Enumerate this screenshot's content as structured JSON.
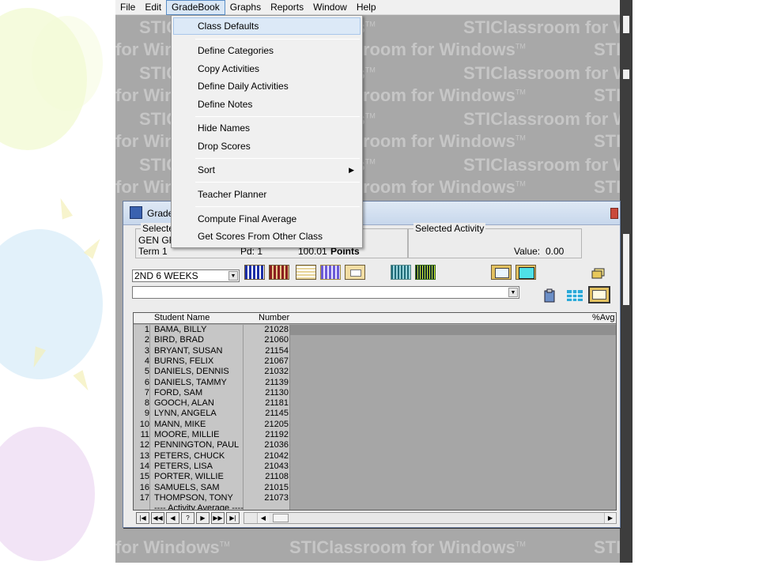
{
  "menubar": {
    "items": [
      "File",
      "Edit",
      "GradeBook",
      "Graphs",
      "Reports",
      "Window",
      "Help"
    ],
    "active": "GradeBook"
  },
  "watermark": {
    "line_a": "STIClassroom for Windows",
    "line_b": "for Windows",
    "tm": "TM"
  },
  "dropdown": {
    "items": [
      {
        "label": "Class Defaults"
      },
      {
        "label": "Define Categories"
      },
      {
        "label": "Copy Activities"
      },
      {
        "label": "Define Daily Activities"
      },
      {
        "label": "Define Notes"
      },
      {
        "label": "Hide Names"
      },
      {
        "label": "Drop Scores"
      },
      {
        "label": "Sort"
      },
      {
        "label": "Teacher Planner"
      },
      {
        "label": "Compute Final Average"
      },
      {
        "label": "Get Scores From Other Class"
      }
    ],
    "highlighted": "Class Defaults",
    "submenu_arrow": "▶"
  },
  "gradebook_window": {
    "title": "Grade",
    "selected_group_legend": "Selecte",
    "class_name": "GEN GR",
    "term": "Term 1",
    "period": "Pd: 1",
    "points_value": "100.01",
    "points_label": "Points",
    "selected_activity_legend": "Selected Activity",
    "value_label": "Value:",
    "value": "0.00",
    "period_select": "2ND 6 WEEKS",
    "category_select": ""
  },
  "grid": {
    "headers": {
      "name": "Student Name",
      "number": "Number",
      "avg": "%Avg"
    },
    "rows": [
      {
        "n": "1",
        "name": "BAMA, BILLY",
        "id": "21028"
      },
      {
        "n": "2",
        "name": "BIRD, BRAD",
        "id": "21060"
      },
      {
        "n": "3",
        "name": "BRYANT, SUSAN",
        "id": "21154"
      },
      {
        "n": "4",
        "name": "BURNS, FELIX",
        "id": "21067"
      },
      {
        "n": "5",
        "name": "DANIELS, DENNIS",
        "id": "21032"
      },
      {
        "n": "6",
        "name": "DANIELS, TAMMY",
        "id": "21139"
      },
      {
        "n": "7",
        "name": "FORD, SAM",
        "id": "21130"
      },
      {
        "n": "8",
        "name": "GOOCH, ALAN",
        "id": "21181"
      },
      {
        "n": "9",
        "name": "LYNN, ANGELA",
        "id": "21145"
      },
      {
        "n": "10",
        "name": "MANN, MIKE",
        "id": "21205"
      },
      {
        "n": "11",
        "name": "MOORE, MILLIE",
        "id": "21192"
      },
      {
        "n": "12",
        "name": "PENNINGTON, PAUL",
        "id": "21036"
      },
      {
        "n": "13",
        "name": "PETERS, CHUCK",
        "id": "21042"
      },
      {
        "n": "14",
        "name": "PETERS, LISA",
        "id": "21043"
      },
      {
        "n": "15",
        "name": "PORTER, WILLIE",
        "id": "21108"
      },
      {
        "n": "16",
        "name": "SAMUELS, SAM",
        "id": "21015"
      },
      {
        "n": "17",
        "name": "THOMPSON, TONY",
        "id": "21073"
      }
    ],
    "footer_row": "---- Activity Average ----"
  },
  "record_nav": [
    "|◀",
    "◀◀",
    "◀",
    "?",
    "▶",
    "▶▶",
    "▶|"
  ],
  "colors": {
    "menu_highlight": "#dce9f7",
    "app_background": "#a8a8a8",
    "selected_row": "#8f8f8f"
  }
}
